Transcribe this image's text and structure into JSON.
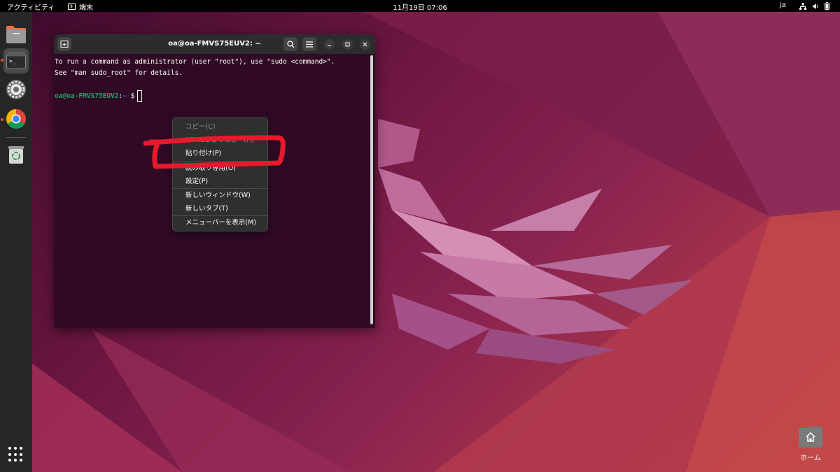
{
  "topbar": {
    "activities": "アクティビティ",
    "app_name": "端末",
    "clock": "11月19日  07:06",
    "lang": "ja",
    "tray_icons": [
      "network-icon",
      "volume-icon",
      "battery-icon"
    ]
  },
  "dock": {
    "items": [
      "files-icon",
      "terminal-icon",
      "settings-icon",
      "chrome-icon",
      "trash-icon"
    ],
    "active": "terminal-icon"
  },
  "desktop": {
    "home_label": "ホーム"
  },
  "terminal": {
    "title": "oa@oa-FMVS75EUV2: ~",
    "lines": [
      "To run a command as administrator (user \"root\"), use \"sudo <command>\".",
      "See \"man sudo_root\" for details."
    ],
    "prompt_user": "oa@oa-FMVS75EUV2",
    "prompt_sep": ":",
    "prompt_path": "~",
    "prompt_symbol": "$"
  },
  "context_menu": {
    "items": [
      {
        "label": "コピー(C)",
        "enabled": false
      },
      {
        "label": "HTMLとしてコピー(H)",
        "enabled": false
      },
      {
        "label": "貼り付け(P)",
        "enabled": true
      },
      {
        "label": "読み取り専用(O)",
        "enabled": true
      },
      {
        "label": "設定(P)",
        "enabled": true
      },
      {
        "label": "新しいウィンドウ(W)",
        "enabled": true
      },
      {
        "label": "新しいタブ(T)",
        "enabled": true
      },
      {
        "label": "メニューバーを表示(M)",
        "enabled": true
      }
    ]
  },
  "colors": {
    "terminal_bg": "#300a24",
    "prompt_user": "#26a269",
    "prompt_path": "#3a7ad8",
    "annotation": "#e8192c",
    "accent": "#e95420"
  }
}
